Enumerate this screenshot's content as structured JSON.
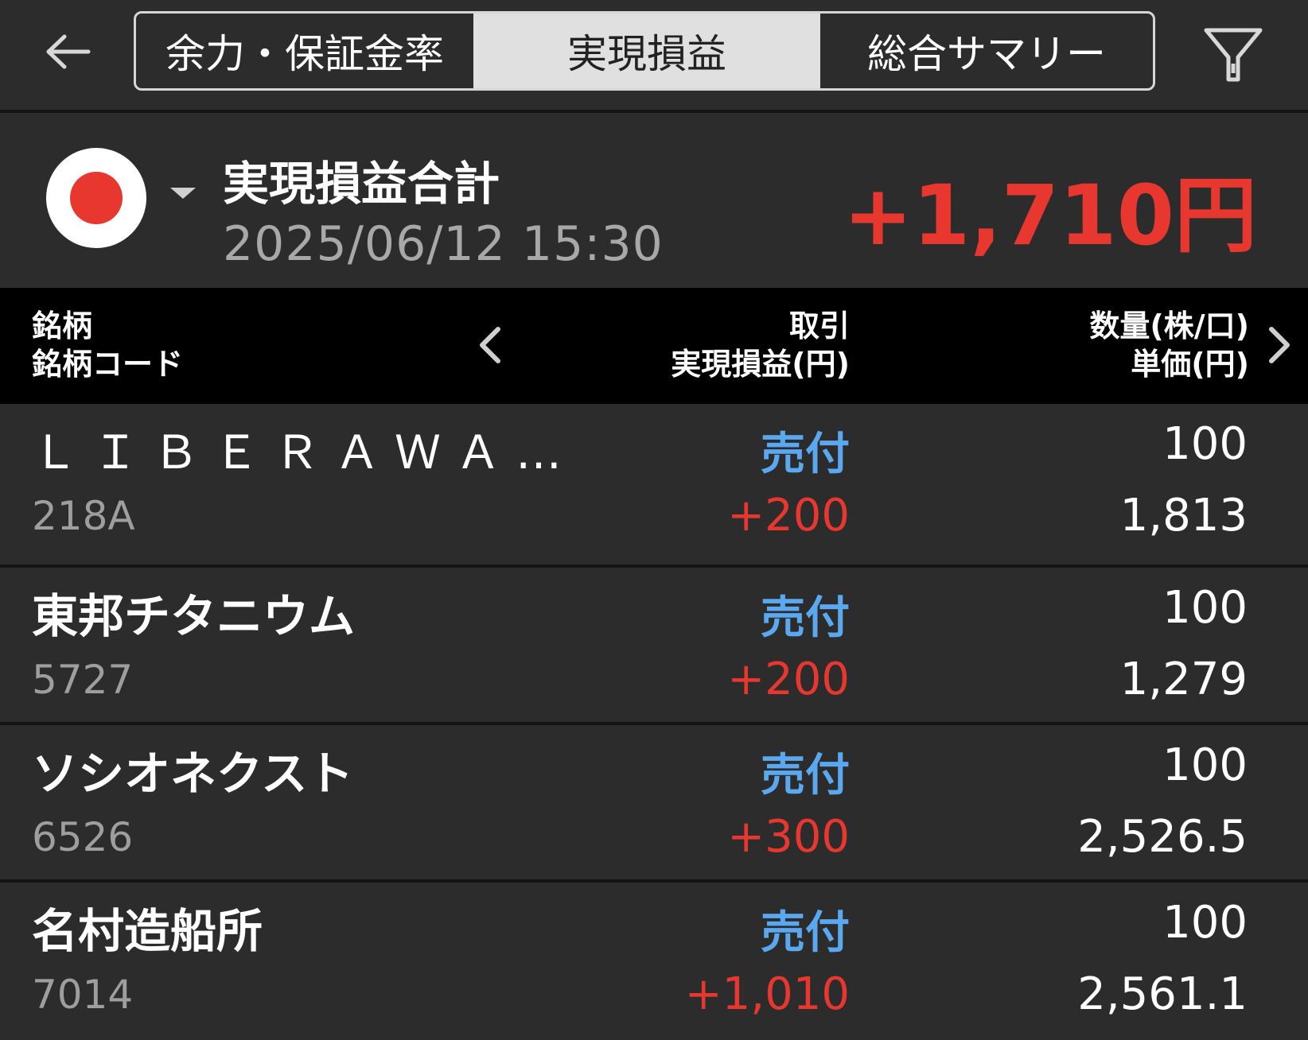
{
  "header": {
    "tabs": [
      {
        "label": "余力・保証金率"
      },
      {
        "label": "実現損益"
      },
      {
        "label": "総合サマリー"
      }
    ],
    "active_tab": "実現損益"
  },
  "summary": {
    "title": "実現損益合計",
    "datetime": "2025/06/12  15:30",
    "total": "+1,710円",
    "market_flag": "japan-flag-icon"
  },
  "table_header": {
    "col1_line1": "銘柄",
    "col1_line2": "銘柄コード",
    "col2_line1": "取引",
    "col2_line2": "実現損益(円)",
    "col3_line1": "数量(株/口)",
    "col3_line2": "単価(円)"
  },
  "rows": [
    {
      "name": "ＬＩＢＥＲＡＷＡ…",
      "code": "218A",
      "trade": "売付",
      "pl": "+200",
      "qty": "100",
      "price": "1,813"
    },
    {
      "name": "東邦チタニウム",
      "code": "5727",
      "trade": "売付",
      "pl": "+200",
      "qty": "100",
      "price": "1,279"
    },
    {
      "name": "ソシオネクスト",
      "code": "6526",
      "trade": "売付",
      "pl": "+300",
      "qty": "100",
      "price": "2,526.5"
    },
    {
      "name": "名村造船所",
      "code": "7014",
      "trade": "売付",
      "pl": "+1,010",
      "qty": "100",
      "price": "2,561.1"
    }
  ],
  "colors": {
    "profit": "#e8372f",
    "trade_sell": "#5aa9f0",
    "background": "#2c2c2c",
    "header_bg": "#000000"
  }
}
